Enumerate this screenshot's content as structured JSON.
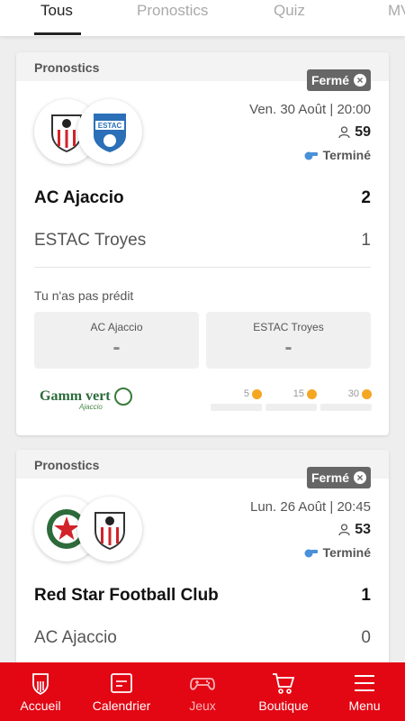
{
  "tabs": [
    {
      "label": "Tous",
      "active": true
    },
    {
      "label": "Pronostics",
      "active": false
    },
    {
      "label": "Quiz",
      "active": false
    },
    {
      "label": "MV",
      "active": false
    }
  ],
  "cards": [
    {
      "header": "Pronostics",
      "status": "Fermé",
      "date": "Ven. 30 Août | 20:00",
      "count": "59",
      "state": "Terminé",
      "home": {
        "name": "AC Ajaccio",
        "score": "2"
      },
      "away": {
        "name": "ESTAC Troyes",
        "score": "1"
      },
      "no_prediction": "Tu n'as pas prédit",
      "pred_home": {
        "label": "AC Ajaccio",
        "value": "-"
      },
      "pred_away": {
        "label": "ESTAC Troyes",
        "value": "-"
      },
      "sponsor": {
        "name": "Gamm vert",
        "sub": "Ajaccio"
      },
      "tiers": [
        "5",
        "15",
        "30"
      ]
    },
    {
      "header": "Pronostics",
      "status": "Fermé",
      "date": "Lun. 26 Août | 20:45",
      "count": "53",
      "state": "Terminé",
      "home": {
        "name": "Red Star Football Club",
        "score": "1"
      },
      "away": {
        "name": "AC Ajaccio",
        "score": "0"
      }
    }
  ],
  "bottom_nav": [
    {
      "label": "Accueil",
      "icon": "home-icon"
    },
    {
      "label": "Calendrier",
      "icon": "calendar-icon"
    },
    {
      "label": "Jeux",
      "icon": "gamepad-icon"
    },
    {
      "label": "Boutique",
      "icon": "cart-icon"
    },
    {
      "label": "Menu",
      "icon": "menu-icon"
    }
  ],
  "colors": {
    "accent": "#e30613",
    "badge": "#666666",
    "coin": "#f5a623"
  }
}
